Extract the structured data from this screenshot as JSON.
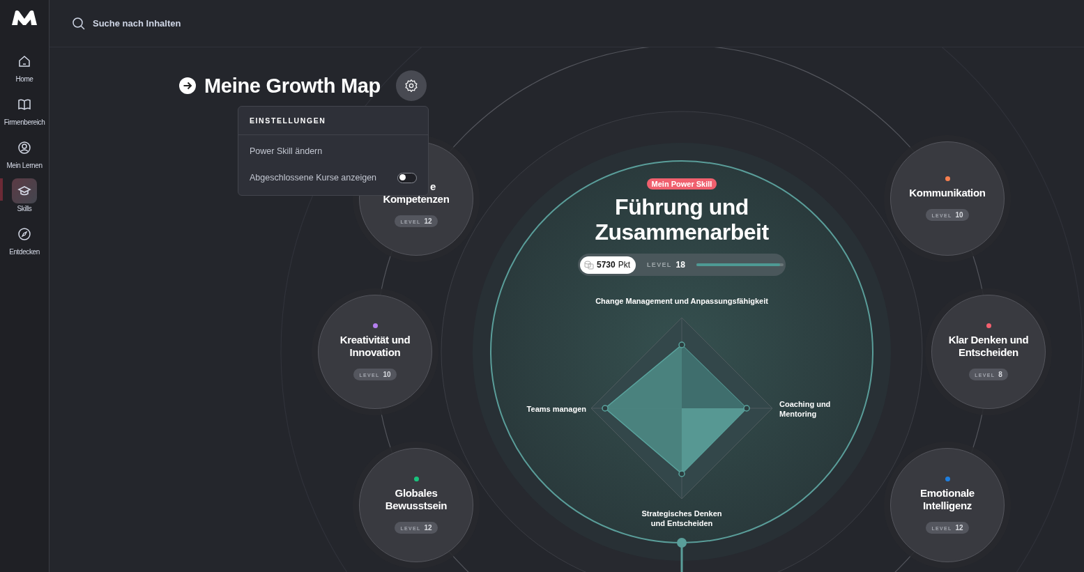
{
  "search": {
    "placeholder": "Suche nach Inhalten"
  },
  "sidebar": {
    "items": [
      {
        "label": "Home",
        "selected": false
      },
      {
        "label": "Firmenbereich",
        "selected": false
      },
      {
        "label": "Mein Lernen",
        "selected": false
      },
      {
        "label": "Skills",
        "selected": true
      },
      {
        "label": "Entdecken",
        "selected": false
      }
    ]
  },
  "page": {
    "title": "Meine Growth Map"
  },
  "settings_menu": {
    "heading": "EINSTELLUNGEN",
    "items": [
      {
        "kind": "action",
        "label": "Power Skill ändern"
      },
      {
        "kind": "toggle",
        "label": "Abgeschlossene Kurse anzeigen",
        "on": false
      }
    ]
  },
  "power_skill": {
    "badge": "Mein Power Skill",
    "title": "Führung und Zusammenarbeit",
    "points": "5730",
    "points_unit": "Pkt",
    "level_label": "LEVEL",
    "level_value": "18",
    "level": 0.96,
    "radar_labels": [
      "Change Management und Anpassungsfähigkeit",
      "Coaching und Mentoring",
      "Strategisches Denken und Entscheiden",
      "Teams managen"
    ]
  },
  "skills": [
    {
      "title_lines": [
        "e",
        "Kompetenzen"
      ],
      "level_label": "LEVEL",
      "level_value": "12"
    },
    {
      "title_lines": [
        "Kreativität und",
        "Innovation"
      ],
      "color": "#b57fef",
      "level_label": "LEVEL",
      "level_value": "10"
    },
    {
      "title_lines": [
        "Globales",
        "Bewusstsein"
      ],
      "color": "#19c37d",
      "level_label": "LEVEL",
      "level_value": "12"
    },
    {
      "title_lines": [
        "Kommunikation"
      ],
      "color": "#f77f4f",
      "level_label": "LEVEL",
      "level_value": "10"
    },
    {
      "title_lines": [
        "Klar Denken und",
        "Entscheiden"
      ],
      "color": "#f5606f",
      "level_label": "LEVEL",
      "level_value": "8"
    },
    {
      "title_lines": [
        "Emotionale",
        "Intelligenz"
      ],
      "color": "#1e7fe0",
      "level_label": "LEVEL",
      "level_value": "12"
    }
  ]
}
